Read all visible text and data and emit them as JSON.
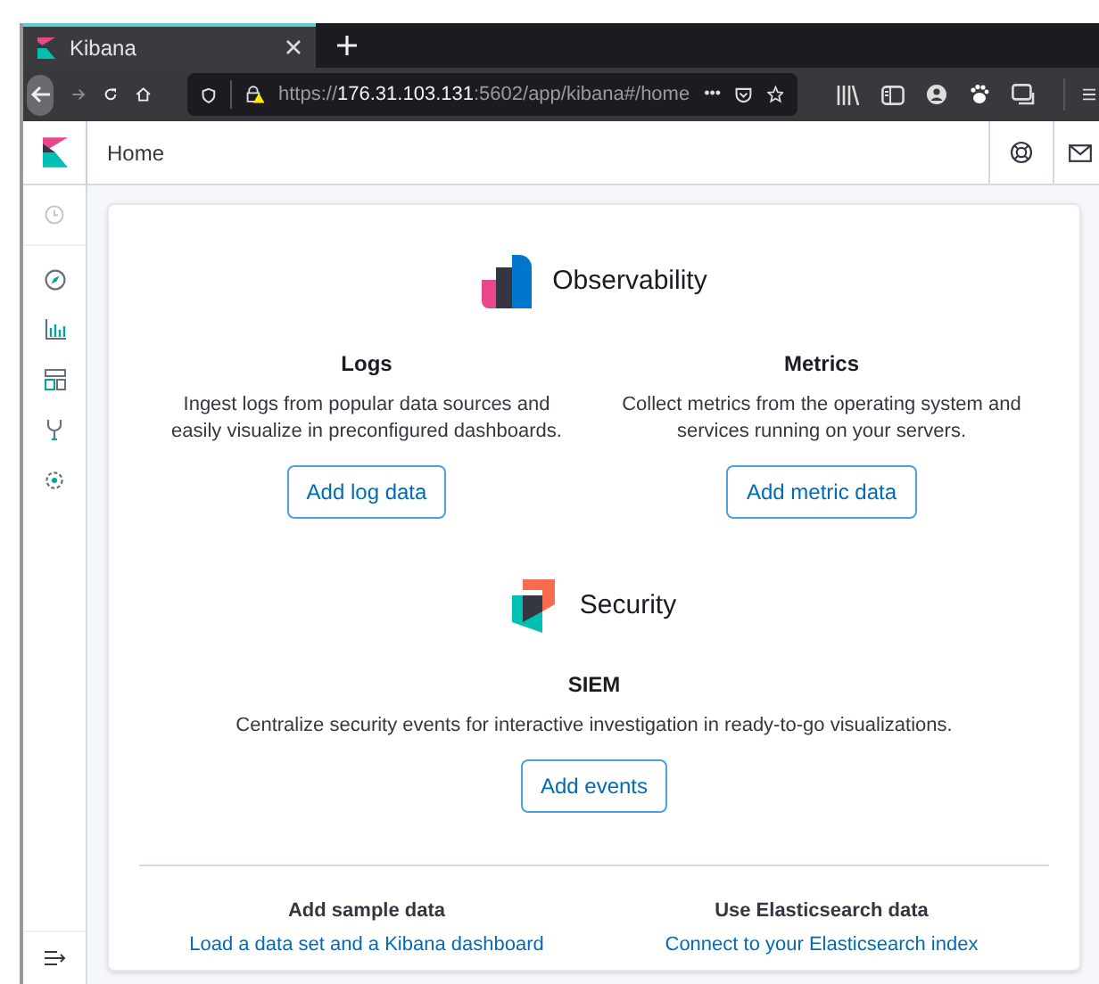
{
  "browser": {
    "tab_title": "Kibana",
    "url": {
      "scheme": "https://",
      "host": "176.31.103.131",
      "path": ":5602/app/kibana#/home"
    },
    "url_more": "•••"
  },
  "header": {
    "breadcrumb": "Home"
  },
  "sections": [
    {
      "kind": "observability",
      "title": "Observability",
      "cards": [
        {
          "title": "Logs",
          "description": "Ingest logs from popular data sources and easily visualize in preconfigured dashboards.",
          "button": "Add log data"
        },
        {
          "title": "Metrics",
          "description": "Collect metrics from the operating system and services running on your servers.",
          "button": "Add metric data"
        }
      ]
    },
    {
      "kind": "security",
      "title": "Security",
      "cards": [
        {
          "title": "SIEM",
          "description": "Centralize security events for interactive investigation in ready-to-go visualizations.",
          "button": "Add events"
        }
      ]
    }
  ],
  "footer": [
    {
      "title": "Add sample data",
      "link": "Load a data set and a Kibana dashboard"
    },
    {
      "title": "Use Elasticsearch data",
      "link": "Connect to your Elasticsearch index"
    }
  ]
}
